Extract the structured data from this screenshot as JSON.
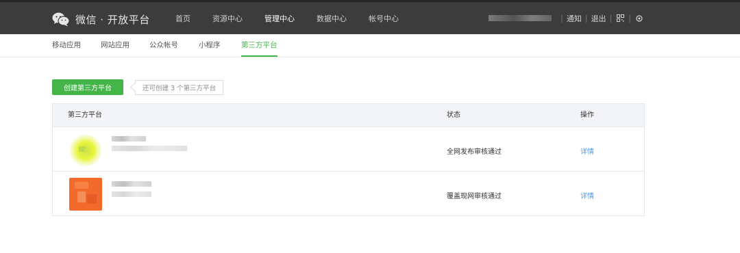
{
  "header": {
    "logo_text": "微信 · 开放平台",
    "nav": [
      "首页",
      "资源中心",
      "管理中心",
      "数据中心",
      "帐号中心"
    ],
    "active_nav": "管理中心",
    "user": {
      "notify_label": "通知",
      "logout_label": "退出",
      "qr_icon": "qr-code-icon",
      "settings_icon": "settings-icon"
    }
  },
  "subnav": {
    "items": [
      "移动应用",
      "网站应用",
      "公众帐号",
      "小程序",
      "第三方平台"
    ],
    "active": "第三方平台"
  },
  "toolbar": {
    "create_label": "创建第三方平台",
    "tip": "还可创建 3 个第三方平台"
  },
  "table": {
    "columns": [
      "第三方平台",
      "状态",
      "操作"
    ],
    "rows": [
      {
        "status": "全网发布审核通过",
        "action": "详情"
      },
      {
        "status": "覆盖现网审核通过",
        "action": "详情"
      }
    ]
  },
  "colors": {
    "brand_green": "#44b549",
    "link_blue": "#459ae9",
    "topbar_bg": "#3c3c3c"
  }
}
